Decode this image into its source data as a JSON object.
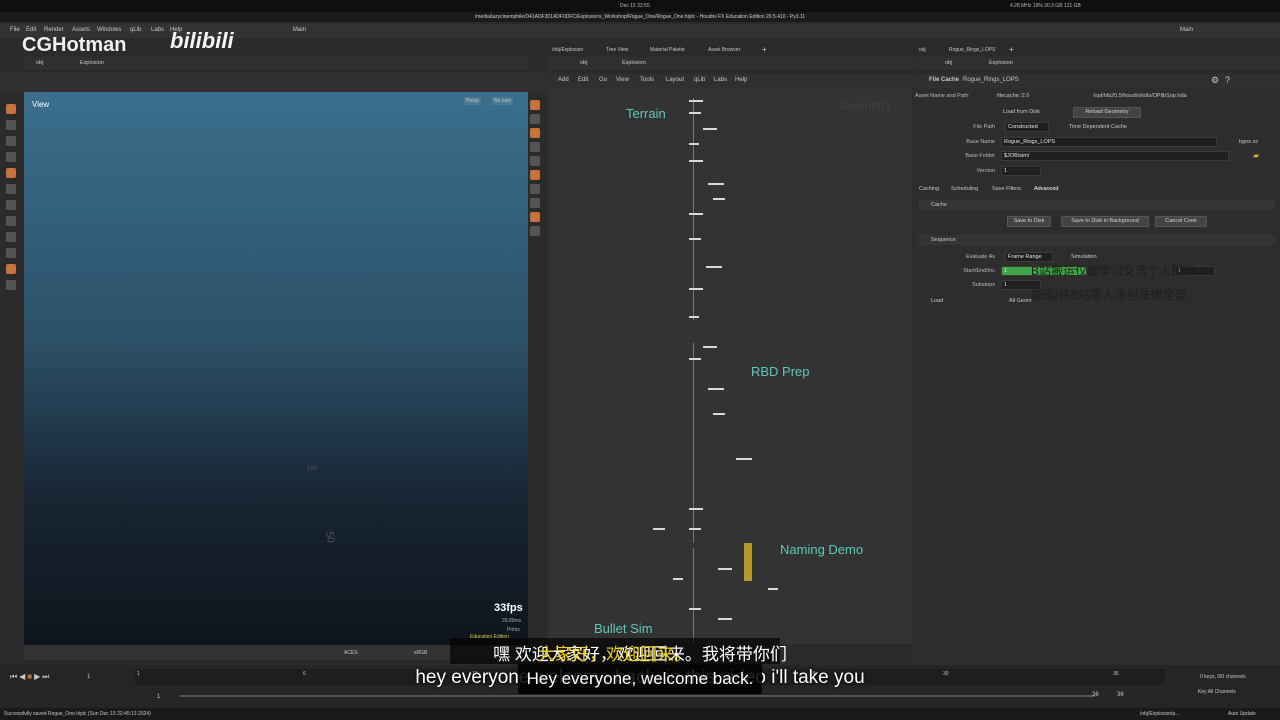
{
  "system": {
    "clock": "Dec 15 22:55",
    "status": "4.28 MHz 19% 30.3 GB 121 GB",
    "title": "/media/lazycinemphile/D41ADF301ADF0DFC/Explosions_Workshop/Rogue_One/Rogue_One.hiplc - Houdini FX Education Edition 20.5.410 - Py3.11"
  },
  "menu": {
    "file": "File",
    "edit": "Edit",
    "render": "Render",
    "assets": "Assets",
    "windows": "Windows",
    "qlib": "qLib",
    "labs": "Labs",
    "help": "Help",
    "desktop": "Main",
    "right_desktop": "Main"
  },
  "watermark": {
    "brand": "CGHotman",
    "logo": "bilibili"
  },
  "left_pane": {
    "path_obj": "obj",
    "path_node": "Explosion",
    "view_label": "View",
    "persp": "Persp",
    "nocam": "No cam",
    "fps": "33fps",
    "fps_ms": "29.89ms",
    "prims": "Prims",
    "edu": "Education Edition",
    "ocio": "ACES",
    "srgb": "sRGB",
    "grid_label_1": "100",
    "grid_label_2": "50"
  },
  "network": {
    "tabs": [
      "/obj/Explosion",
      "Tree View",
      "Material Palette",
      "Asset Browser"
    ],
    "path_obj": "obj",
    "path_node": "Explosion",
    "menu": [
      "Add",
      "Edit",
      "Go",
      "View",
      "Tools",
      "Layout",
      "qLib",
      "Labs",
      "Help"
    ],
    "context_label": "Geometry",
    "labels": {
      "terrain": "Terrain",
      "rbd_prep": "RBD Prep",
      "naming_demo": "Naming Demo",
      "bullet_sim": "Bullet Sim"
    }
  },
  "params": {
    "tabs": [
      "obj",
      "Rogue_Rings_LOPS"
    ],
    "path_obj": "obj",
    "path_node": "Explosion",
    "node_type": "File Cache",
    "node_name": "Rogue_Rings_LOPS",
    "asset_label": "Asset Name and Path",
    "asset_name": "filecache::2.0",
    "asset_path": "/opt/hfs20.5/houdini/otls/OPlibSop.hda",
    "load_from_disk": "Load from Disk",
    "reload_geometry": "Reload Geometry",
    "file_path_label": "File Path",
    "file_path_value": "Constructed",
    "time_dependent": "Time Dependent Cache",
    "base_name_label": "Base Name",
    "base_name_value": "Rogue_Rings_LOPS",
    "base_ext": "bgeo.sc",
    "base_folder_label": "Base Folder",
    "base_folder_value": "$JOB/sim/",
    "version_label": "Version",
    "version_value": "1",
    "sub_tabs": [
      "Caching",
      "Scheduling",
      "Save Filters",
      "Advanced"
    ],
    "cache_section": "Cache",
    "save_to_disk": "Save to Disk",
    "save_bg": "Save to Disk in Background",
    "cancel_cook": "Cancel Cook",
    "sequence_section": "Sequence",
    "evaluate_as_label": "Evaluate As",
    "evaluate_as_value": "Frame Range",
    "simulation": "Simulation",
    "start_end_label": "Start/End/Inc",
    "start_value": "1",
    "end_value": "1",
    "substeps_label": "Substeps",
    "substeps_value": "1",
    "load_section": "Load",
    "all_geom": "All Geom",
    "overlay_line1": "B站搬运仅做学习交流个人翻译",
    "overlay_line2": "搬运/转B站等人承担法律全部"
  },
  "timeline": {
    "frame_start": "1",
    "frame_current": "1",
    "frame_end": "36",
    "frame_end2": "36",
    "keys": "0 keys, 0/0 channels",
    "key_all": "Key All Channels",
    "auto_update": "Auto Update",
    "status": "Successfully saved Rogue_One.hiplc (Sun Dec 15 22:45:13 2024)",
    "path": "/obj/Explosion/p..."
  },
  "ticks": [
    "1",
    "6",
    "12",
    "18",
    "24",
    "30",
    "36"
  ],
  "subtitles": {
    "zh": "嘿 欢迎大家好，欢迎回来。我将带你们",
    "zh_highlight": "大家好，欢迎回来。",
    "en": "hey everyone welcome back. in this video i'll take you",
    "en_box": "Hey everyone, welcome back."
  },
  "colors": {
    "accent_orange": "#c8723a",
    "net_label": "#5fc9b8",
    "subtitle_yellow": "#f2d21b",
    "green_range": "#3fa544"
  }
}
